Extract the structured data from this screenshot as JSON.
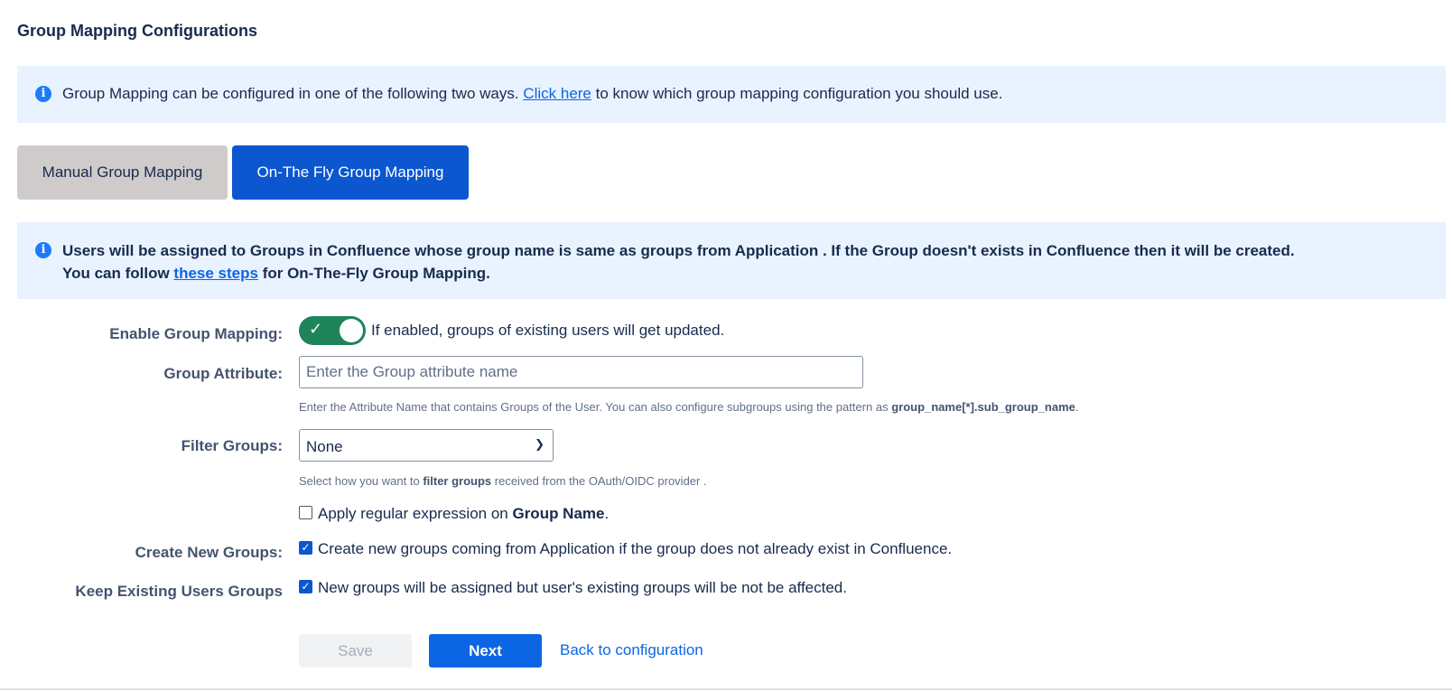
{
  "page": {
    "title": "Group Mapping Configurations"
  },
  "info_banner": {
    "text_before": "Group Mapping can be configured in one of the following two ways. ",
    "link": "Click here",
    "text_after": " to know which group mapping configuration you should use."
  },
  "tabs": [
    {
      "label": "Manual Group Mapping",
      "active": false
    },
    {
      "label": "On-The Fly Group Mapping",
      "active": true
    }
  ],
  "otf_banner": {
    "line1": "Users will be assigned to Groups in Confluence whose group name is same as groups from Application . If the Group doesn't exists in Confluence then it will be created.",
    "line2_before": "You can follow ",
    "line2_link": "these steps",
    "line2_after": " for On-The-Fly Group Mapping."
  },
  "form": {
    "enable_group_mapping": {
      "label": "Enable Group Mapping:",
      "enabled": true,
      "description": "If enabled, groups of existing users will get updated."
    },
    "group_attribute": {
      "label": "Group Attribute:",
      "value": "",
      "placeholder": "Enter the Group attribute name",
      "help_before": "Enter the Attribute Name that contains Groups of the User. You can also configure subgroups using the pattern as ",
      "help_bold": "group_name[*].sub_group_name",
      "help_after": "."
    },
    "filter_groups": {
      "label": "Filter Groups:",
      "selected": "None",
      "help_before": "Select how you want to ",
      "help_bold": "filter groups",
      "help_after": " received from the OAuth/OIDC provider ."
    },
    "apply_regex": {
      "checked": false,
      "text_before": "Apply regular expression on ",
      "text_bold": "Group Name",
      "text_after": "."
    },
    "create_new_groups": {
      "label": "Create New Groups:",
      "checked": true,
      "text": "Create new groups coming from Application if the group does not already exist in Confluence."
    },
    "keep_existing_groups": {
      "label": "Keep Existing Users Groups",
      "checked": true,
      "text": "New groups will be assigned but user's existing groups will be not be affected."
    }
  },
  "actions": {
    "save_label": "Save",
    "next_label": "Next",
    "back_label": "Back to configuration"
  },
  "icons": {
    "info": "info-icon",
    "check": "check-icon",
    "chevron": "chevron-down-icon"
  },
  "colors": {
    "primary": "#0c66e4",
    "tab_active": "#0c56d0",
    "toggle_on": "#1f845a",
    "banner_bg": "#e9f2ff"
  }
}
